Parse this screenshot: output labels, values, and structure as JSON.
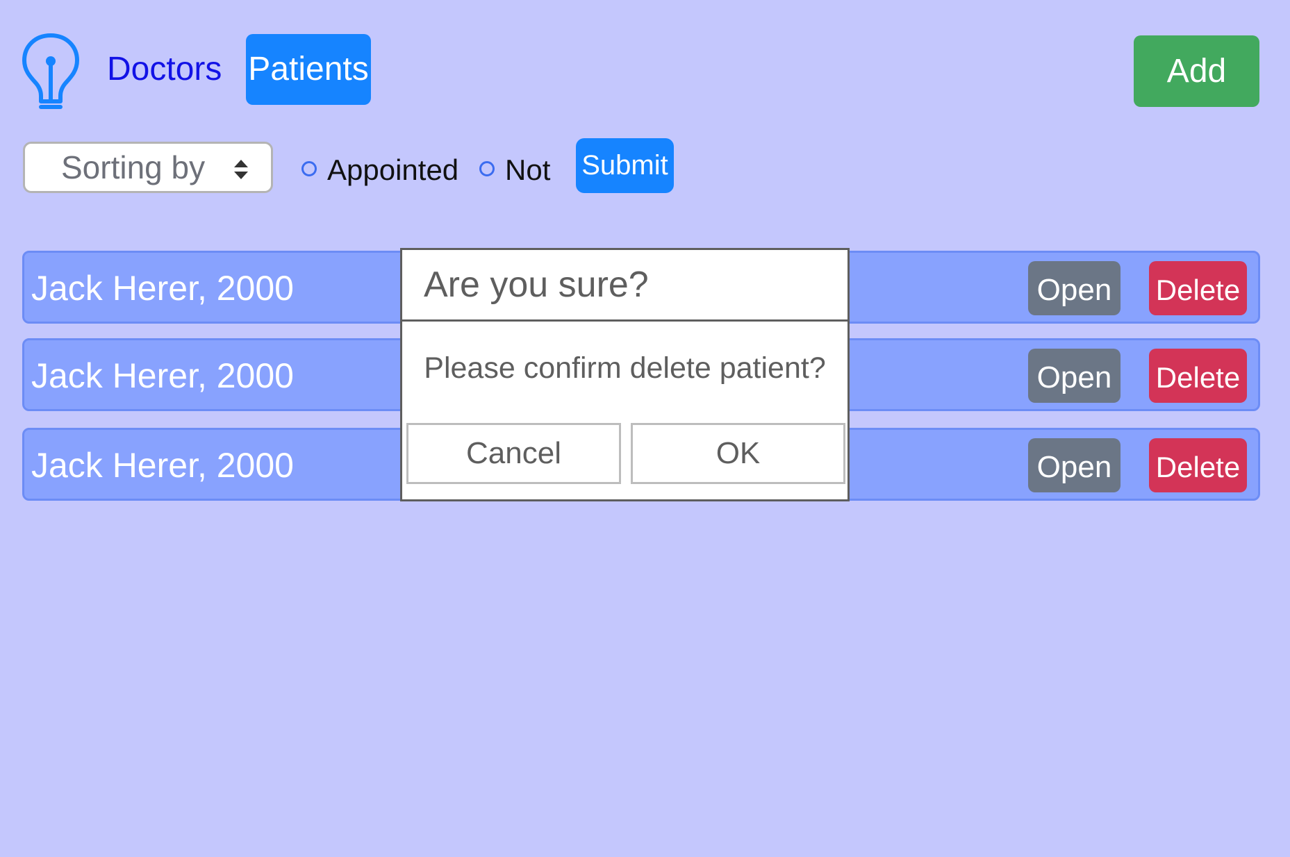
{
  "nav": {
    "logo_icon": "lightbulb-icon",
    "doctors_label": "Doctors",
    "patients_label": "Patients",
    "add_label": "Add"
  },
  "filters": {
    "sort_placeholder": "Sorting by",
    "sort_icon": "sort-arrows-icon",
    "appointed_label": "Appointed",
    "not_label": "Not",
    "submit_label": "Submit"
  },
  "patients": [
    {
      "name": "Jack Herer, 2000",
      "open_label": "Open",
      "delete_label": "Delete"
    },
    {
      "name": "Jack Herer, 2000",
      "open_label": "Open",
      "delete_label": "Delete"
    },
    {
      "name": "Jack Herer, 2000",
      "open_label": "Open",
      "delete_label": "Delete"
    }
  ],
  "dialog": {
    "title": "Are you sure?",
    "message": "Please confirm delete patient?",
    "cancel_label": "Cancel",
    "ok_label": "OK"
  },
  "colors": {
    "background": "#c4c7fd",
    "primary": "#1684ff",
    "success": "#42a95e",
    "row": "#88a2fe",
    "secondary": "#6b7686",
    "danger": "#d33457"
  }
}
